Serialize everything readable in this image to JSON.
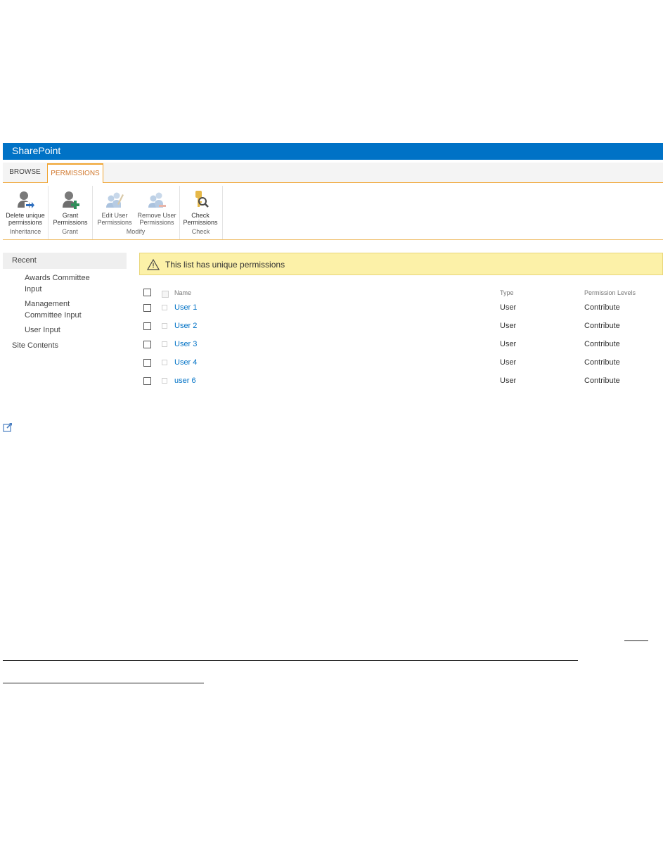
{
  "suitebar": {
    "brand": "SharePoint"
  },
  "ribbon": {
    "tabs": {
      "browse": "BROWSE",
      "permissions": "PERMISSIONS"
    },
    "groups": {
      "inheritance": {
        "label": "Inheritance",
        "delete_unique": "Delete unique\npermissions"
      },
      "grant": {
        "label": "Grant",
        "grant_permissions": "Grant\nPermissions"
      },
      "modify": {
        "label": "Modify",
        "edit_user": "Edit User\nPermissions",
        "remove_user": "Remove User\nPermissions"
      },
      "check": {
        "label": "Check",
        "check_permissions": "Check\nPermissions"
      }
    }
  },
  "nav": {
    "recent": "Recent",
    "items": [
      "Awards Committee Input",
      "Management Committee Input",
      "User Input"
    ],
    "site_contents": "Site Contents"
  },
  "banner": {
    "text": "This list has unique permissions"
  },
  "table": {
    "headers": {
      "name": "Name",
      "type": "Type",
      "permission_levels": "Permission Levels"
    },
    "rows": [
      {
        "name": "User 1",
        "type": "User",
        "permission": "Contribute"
      },
      {
        "name": "User 2",
        "type": "User",
        "permission": "Contribute"
      },
      {
        "name": "User 3",
        "type": "User",
        "permission": "Contribute"
      },
      {
        "name": "User 4",
        "type": "User",
        "permission": "Contribute"
      },
      {
        "name": "user 6",
        "type": "User",
        "permission": "Contribute"
      }
    ]
  },
  "colors": {
    "suitebar": "#0072c6",
    "accent": "#f0a430",
    "link": "#0072c6",
    "banner": "#fcf1a8"
  }
}
